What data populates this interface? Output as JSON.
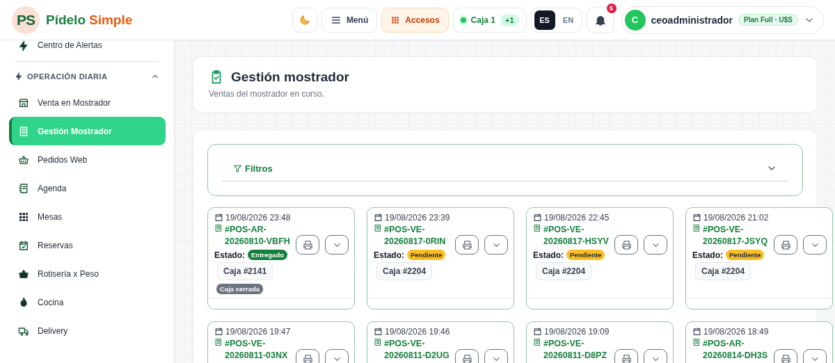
{
  "header": {
    "logo": {
      "mark": "PS",
      "name_first": "Pídelo",
      "name_second": "Simple"
    },
    "menu_label": "Menú",
    "access_label": "Accesos",
    "cash_register": {
      "label": "Caja 1",
      "extra": "+1"
    },
    "languages": [
      {
        "label": "ES",
        "selected": true
      },
      {
        "label": "EN",
        "selected": false
      }
    ],
    "notifications": {
      "count": "5"
    },
    "user": {
      "initial": "C",
      "name": "ceoadministrador",
      "plan": "Plan Full · U$S"
    }
  },
  "sidebar": {
    "top_items": [
      {
        "label": "Centro de Alertas",
        "selected": false
      }
    ],
    "section": {
      "title": "OPERACIÓN DIARIA",
      "expanded": true,
      "items": [
        {
          "label": "Venta en Mostrador",
          "selected": false
        },
        {
          "label": "Gestión Mostrador",
          "selected": true
        },
        {
          "label": "Pedidos Web",
          "selected": false
        },
        {
          "label": "Agenda",
          "selected": false
        },
        {
          "label": "Mesas",
          "selected": false
        },
        {
          "label": "Reservas",
          "selected": false
        },
        {
          "label": "Rotisería x Peso",
          "selected": false
        },
        {
          "label": "Cocina",
          "selected": false
        },
        {
          "label": "Delivery",
          "selected": false
        }
      ]
    }
  },
  "page_header": {
    "title": "Gestión mostrador",
    "subtitle": "Ventas del mostrador en curso."
  },
  "filters": {
    "label": "Filtros",
    "expanded": false
  },
  "orders": [
    {
      "date": "19/08/2026 23:48",
      "number": "#POS-AR-20260810-VBFH",
      "status_label": "Estado:",
      "status": {
        "label": "Entregado",
        "kind": "delivered"
      },
      "register": "Caja #2141",
      "register_note": "Caja cerrada"
    },
    {
      "date": "19/08/2026 23:39",
      "number": "#POS-VE-20260817-0RIN",
      "status_label": "Estado:",
      "status": {
        "label": "Pendiente",
        "kind": "pending"
      },
      "register": "Caja #2204"
    },
    {
      "date": "19/08/2026 22:45",
      "number": "#POS-VE-20260817-HSYV",
      "status_label": "Estado:",
      "status": {
        "label": "Pendiente",
        "kind": "pending"
      },
      "register": "Caja #2204"
    },
    {
      "date": "19/08/2026 21:02",
      "number": "#POS-VE-20260817-JSYQ",
      "status_label": "Estado:",
      "status": {
        "label": "Pendiente",
        "kind": "pending"
      },
      "register": "Caja #2204"
    },
    {
      "date": "19/08/2026 19:47",
      "number": "#POS-VE-20260811-03NX"
    },
    {
      "date": "19/08/2026 19:46",
      "number": "#POS-VE-20260811-D2UG"
    },
    {
      "date": "19/08/2026 19:09",
      "number": "#POS-VE-20260811-D8PZ"
    },
    {
      "date": "19/08/2026 18:49",
      "number": "#POS-AR-20260814-DH3S"
    }
  ]
}
